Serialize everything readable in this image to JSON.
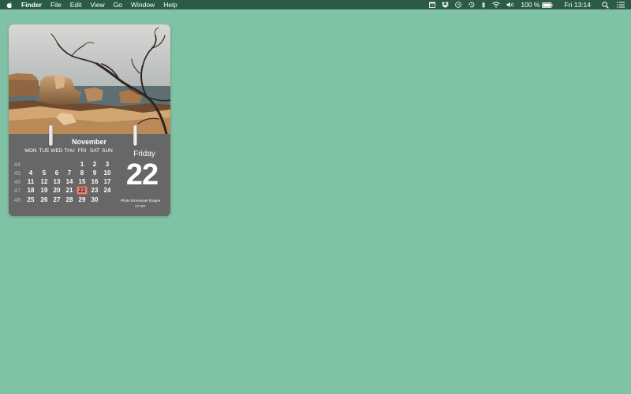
{
  "menubar": {
    "apple_icon": "apple-icon",
    "app_name": "Finder",
    "menus": [
      "File",
      "Edit",
      "View",
      "Go",
      "Window",
      "Help"
    ],
    "status": {
      "icons": [
        "calendar-icon",
        "dropbox-icon",
        "sync-icon",
        "time-machine-icon",
        "bluetooth-icon",
        "wifi-icon",
        "volume-icon"
      ],
      "battery_text": "100 %",
      "clock": "Fri 13:14",
      "right_icons": [
        "search-icon",
        "list-icon"
      ]
    }
  },
  "calendar": {
    "month": "November",
    "weekday_headers": [
      "MON",
      "TUE",
      "WED",
      "THU",
      "FRI",
      "SAT",
      "SUN"
    ],
    "weeks": [
      {
        "number": "44",
        "days": [
          "",
          "",
          "",
          "",
          "1",
          "2",
          "3"
        ]
      },
      {
        "number": "45",
        "days": [
          "4",
          "5",
          "6",
          "7",
          "8",
          "9",
          "10"
        ]
      },
      {
        "number": "46",
        "days": [
          "11",
          "12",
          "13",
          "14",
          "15",
          "16",
          "17"
        ]
      },
      {
        "number": "47",
        "days": [
          "18",
          "19",
          "20",
          "21",
          "22",
          "23",
          "24"
        ]
      },
      {
        "number": "48",
        "days": [
          "25",
          "26",
          "27",
          "28",
          "29",
          "30",
          ""
        ]
      }
    ],
    "today": "22",
    "weekday_name": "Friday",
    "big_date": "22",
    "credit_line1": "Photo Emmanuel Eragne",
    "credit_line2": "CC BY"
  }
}
